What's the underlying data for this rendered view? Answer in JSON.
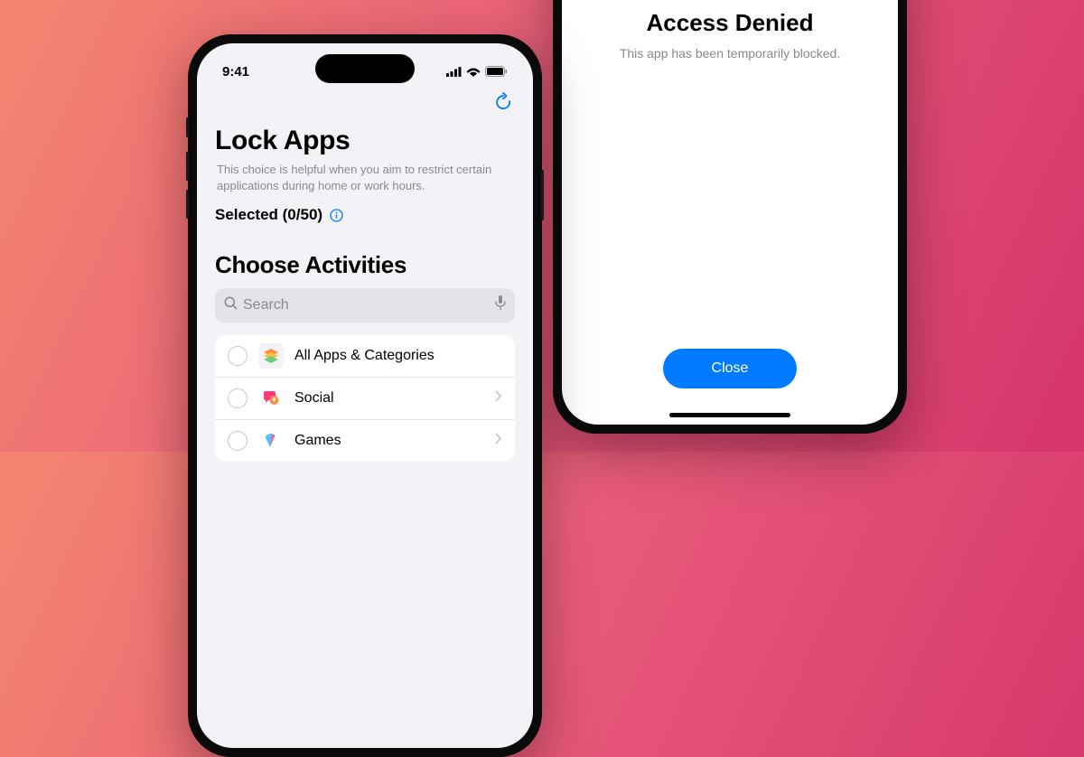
{
  "left_phone": {
    "status": {
      "time": "9:41"
    },
    "page_title": "Lock Apps",
    "page_subtitle": "This choice is helpful when you aim to restrict certain applications during home or work hours.",
    "selected_label": "Selected (0/50)",
    "section_title": "Choose Activities",
    "search_placeholder": "Search",
    "list": [
      {
        "label": "All Apps & Categories",
        "icon": "stack",
        "has_chevron": false
      },
      {
        "label": "Social",
        "icon": "social",
        "has_chevron": true
      },
      {
        "label": "Games",
        "icon": "games",
        "has_chevron": true
      }
    ]
  },
  "right_phone": {
    "denied_title": "Access Denied",
    "denied_subtitle": "This app has been temporarily blocked.",
    "close_label": "Close"
  }
}
